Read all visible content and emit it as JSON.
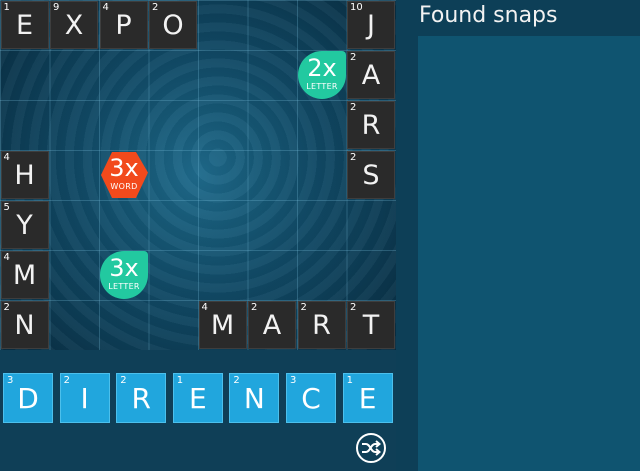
{
  "side_panel": {
    "title": "Found snaps"
  },
  "board": {
    "tiles": [
      {
        "letter": "E",
        "points": "1",
        "col": 0,
        "row": 0
      },
      {
        "letter": "X",
        "points": "9",
        "col": 1,
        "row": 0
      },
      {
        "letter": "P",
        "points": "4",
        "col": 2,
        "row": 0
      },
      {
        "letter": "O",
        "points": "2",
        "col": 3,
        "row": 0
      },
      {
        "letter": "J",
        "points": "10",
        "col": 7,
        "row": 0
      },
      {
        "letter": "A",
        "points": "2",
        "col": 7,
        "row": 1
      },
      {
        "letter": "R",
        "points": "2",
        "col": 7,
        "row": 2
      },
      {
        "letter": "S",
        "points": "2",
        "col": 7,
        "row": 3
      },
      {
        "letter": "H",
        "points": "4",
        "col": 0,
        "row": 3
      },
      {
        "letter": "Y",
        "points": "5",
        "col": 0,
        "row": 4
      },
      {
        "letter": "M",
        "points": "4",
        "col": 0,
        "row": 5
      },
      {
        "letter": "N",
        "points": "2",
        "col": 0,
        "row": 6
      },
      {
        "letter": "M",
        "points": "4",
        "col": 4,
        "row": 6
      },
      {
        "letter": "A",
        "points": "2",
        "col": 5,
        "row": 6
      },
      {
        "letter": "R",
        "points": "2",
        "col": 6,
        "row": 6
      },
      {
        "letter": "T",
        "points": "2",
        "col": 7,
        "row": 6
      }
    ],
    "bonuses": [
      {
        "value": "2x",
        "kind": "LETTER",
        "col": 6,
        "row": 1,
        "color": "#22c9a0",
        "shape": "letter"
      },
      {
        "value": "3x",
        "kind": "WORD",
        "col": 2,
        "row": 3,
        "color": "#f24a1c",
        "shape": "word"
      },
      {
        "value": "3x",
        "kind": "LETTER",
        "col": 2,
        "row": 5,
        "color": "#22c9a0",
        "shape": "letter"
      }
    ]
  },
  "rack": {
    "tiles": [
      {
        "letter": "D",
        "points": "3"
      },
      {
        "letter": "I",
        "points": "2"
      },
      {
        "letter": "R",
        "points": "2"
      },
      {
        "letter": "E",
        "points": "1"
      },
      {
        "letter": "N",
        "points": "2"
      },
      {
        "letter": "C",
        "points": "3"
      },
      {
        "letter": "E",
        "points": "1"
      }
    ],
    "shuffle_icon": "shuffle-icon"
  },
  "colors": {
    "rack_tile": "#21a6dd",
    "board_tile": "#2a2a2a",
    "panel": "#0f5470"
  }
}
